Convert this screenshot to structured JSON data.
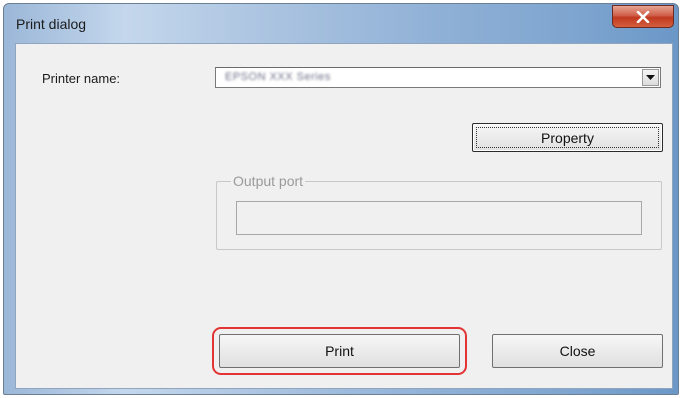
{
  "window": {
    "title": "Print dialog",
    "close_icon": "close-x-icon"
  },
  "printer": {
    "label": "Printer name:",
    "selected_value": "EPSON XXX Series",
    "dropdown_icon": "chevron-down-icon"
  },
  "buttons": {
    "property": "Property",
    "print": "Print",
    "close": "Close"
  },
  "output_port": {
    "legend": "Output port",
    "value": ""
  },
  "colors": {
    "highlight": "#e23434",
    "titlebar": "#8fb0d6",
    "close_button": "#c0391f"
  }
}
